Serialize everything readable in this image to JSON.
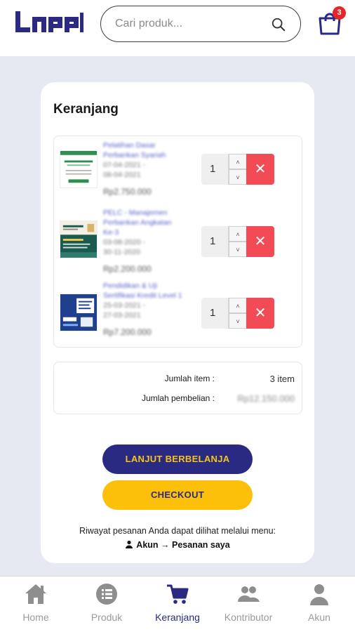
{
  "header": {
    "logo_text": "LPPI",
    "search_placeholder": "Cari produk...",
    "cart_badge": "3"
  },
  "cart": {
    "title": "Keranjang",
    "items": [
      {
        "name_line1": "Pelatihan Dasar",
        "name_line2": "Perbankan Syariah",
        "date_start": "07-04-2021 -",
        "date_end": "08-04-2021",
        "price": "Rp2.750.000",
        "qty": "1"
      },
      {
        "name_line1": "PELC - Manajemen",
        "name_line2": "Perbankan Angkatan",
        "name_line3": "Ke-3",
        "date_start": "03-08-2020 -",
        "date_end": "30-11-2020",
        "price": "Rp2.200.000",
        "qty": "1"
      },
      {
        "name_line1": "Pendidikan & Uji",
        "name_line2": "Sertifikasi Kredit Level 1",
        "date_start": "25-03-2021 -",
        "date_end": "27-03-2021",
        "price": "Rp7.200.000",
        "qty": "1"
      }
    ],
    "delete_symbol": "✕",
    "step_up": "˄",
    "step_down": "˅"
  },
  "summary": {
    "item_count_label": "Jumlah item :",
    "item_count_value": "3 item",
    "total_label": "Jumlah pembelian :",
    "total_value": "Rp12.150.000"
  },
  "actions": {
    "continue_label": "LANJUT BERBELANJA",
    "checkout_label": "CHECKOUT"
  },
  "note": {
    "line1": "Riwayat pesanan Anda dapat dilihat melalui menu:",
    "line2": "Akun → Pesanan saya"
  },
  "nav": {
    "items": [
      {
        "label": "Home",
        "icon": "home-icon"
      },
      {
        "label": "Produk",
        "icon": "list-icon"
      },
      {
        "label": "Keranjang",
        "icon": "cart-icon",
        "active": true
      },
      {
        "label": "Kontributor",
        "icon": "users-icon"
      },
      {
        "label": "Akun",
        "icon": "user-icon"
      }
    ]
  },
  "colors": {
    "primary": "#2b2a83",
    "accent": "#fcc00a",
    "danger": "#f24b55",
    "background": "#e6e8f2"
  }
}
